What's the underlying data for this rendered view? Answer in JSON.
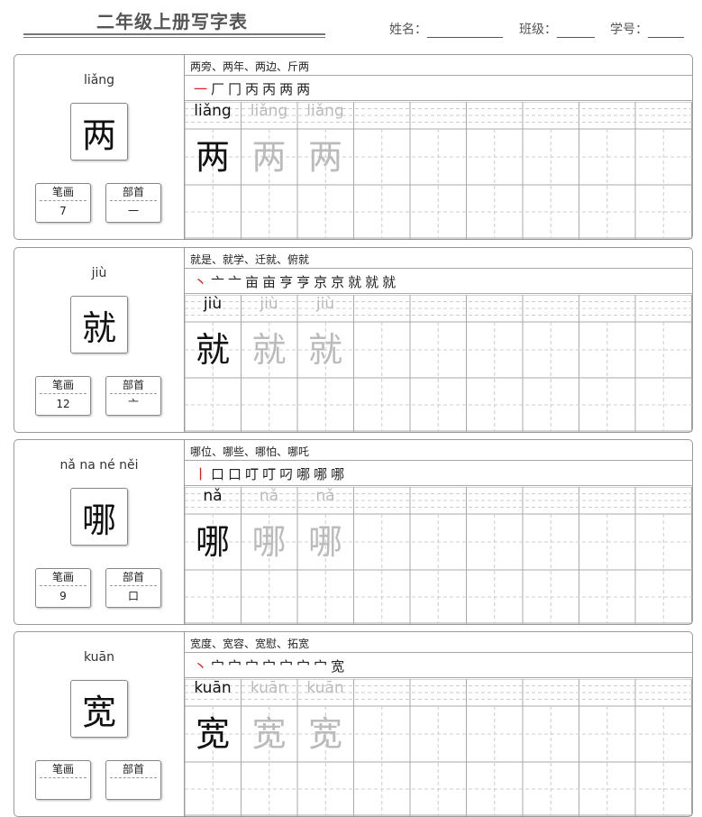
{
  "header": {
    "title": "二年级上册写字表",
    "name_label": "姓名：",
    "class_label": "班级：",
    "number_label": "学号："
  },
  "labels": {
    "strokes": "笔画",
    "radical": "部首"
  },
  "cards": [
    {
      "char": "两",
      "pinyin": "liǎng",
      "stroke_count": "7",
      "radical": "一",
      "words": "两旁、两年、两边、斤两",
      "stroke_steps": [
        "一",
        "厂",
        "冂",
        "丙",
        "丙",
        "两",
        "两"
      ]
    },
    {
      "char": "就",
      "pinyin": "jiù",
      "stroke_count": "12",
      "radical": "亠",
      "words": "就是、就学、迁就、俯就",
      "stroke_steps": [
        "丶",
        "亠",
        "亠",
        "亩",
        "亩",
        "亨",
        "亨",
        "京",
        "京",
        "就",
        "就",
        "就"
      ]
    },
    {
      "char": "哪",
      "pinyin": "nǎ  na  né  něi",
      "pinyin_main": "nǎ",
      "stroke_count": "9",
      "radical": "口",
      "words": "哪位、哪些、哪怕、哪吒",
      "stroke_steps": [
        "丨",
        "口",
        "口",
        "叮",
        "叮",
        "叼",
        "哪",
        "哪",
        "哪"
      ]
    },
    {
      "char": "宽",
      "pinyin": "kuān",
      "stroke_count": "",
      "radical": "",
      "words": "宽度、宽容、宽慰、拓宽",
      "stroke_steps": [
        "丶",
        "宀",
        "宀",
        "宀",
        "宀",
        "宀",
        "宀",
        "宀",
        "宽"
      ]
    }
  ],
  "colors": {
    "accent_stroke": "#e02020",
    "border": "#999999",
    "guide_gray": "#bbbbbb"
  }
}
